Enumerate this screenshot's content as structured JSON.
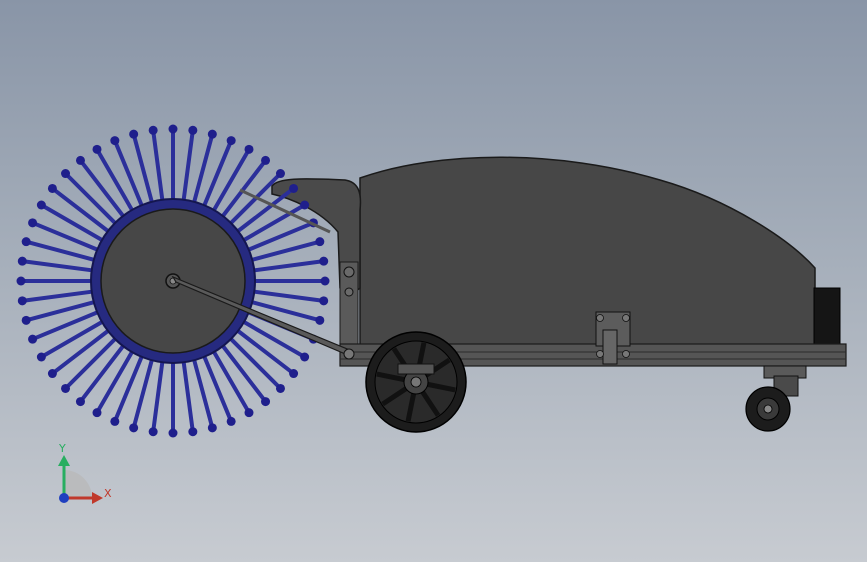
{
  "viewport": {
    "bg_top": "#8995a7",
    "bg_bottom": "#c7cbd1"
  },
  "model": {
    "body_color": "#474747",
    "edge_color": "#1a1a1a",
    "brush_color": "#2b2f9a",
    "brush_tip_color": "#1f1f8c",
    "bristle_count": 48
  },
  "triad": {
    "x_label": "X",
    "y_label": "Y",
    "x_color": "#c0392b",
    "y_color": "#27ae60",
    "z_color": "#1f3fbf"
  }
}
